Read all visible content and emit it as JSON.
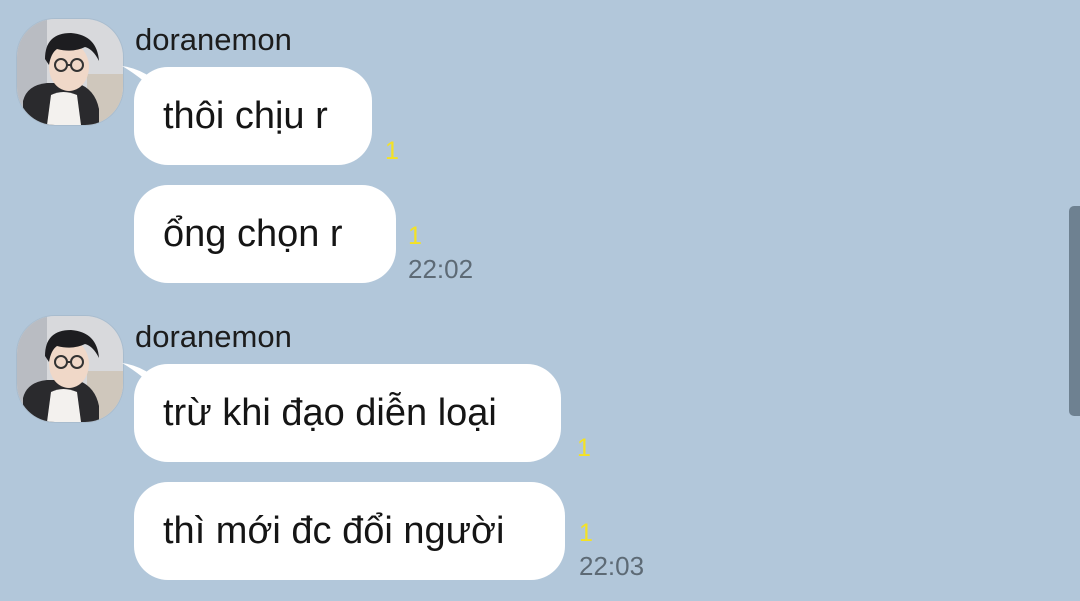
{
  "colors": {
    "background": "#b2c7da",
    "bubble": "#ffffff",
    "unread": "#f4e224",
    "time": "#5d6a75",
    "scrollbar": "#6e8191"
  },
  "groups": [
    {
      "sender": "doranemon",
      "avatar_icon": "profile-photo-avatar",
      "messages": [
        {
          "text": "thôi chịu r",
          "unread": "1"
        },
        {
          "text": "ổng chọn r",
          "unread": "1",
          "time": "22:02"
        }
      ]
    },
    {
      "sender": "doranemon",
      "avatar_icon": "profile-photo-avatar",
      "messages": [
        {
          "text": "trừ khi đạo diễn loại",
          "unread": "1"
        },
        {
          "text": "thì mới đc đổi người",
          "unread": "1",
          "time": "22:03"
        }
      ]
    }
  ]
}
